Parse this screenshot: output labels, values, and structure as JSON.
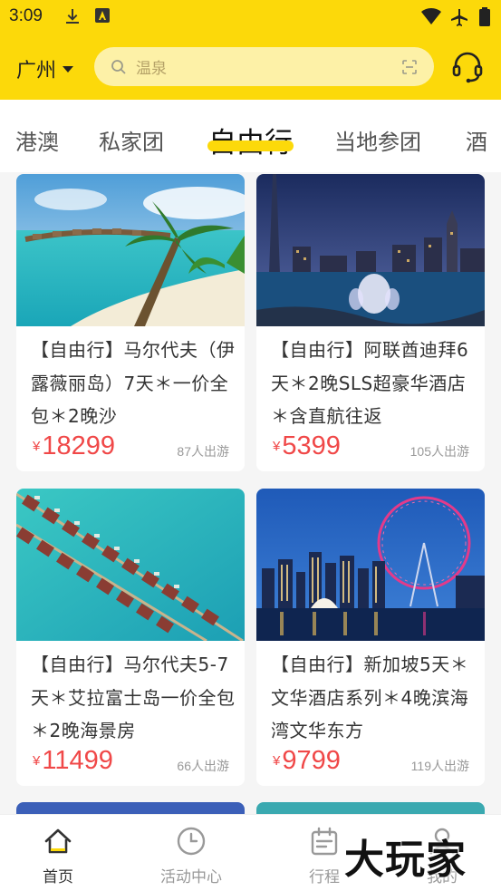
{
  "status_bar": {
    "time": "3:09"
  },
  "header": {
    "city": "广州",
    "search_placeholder": "温泉"
  },
  "tabs": [
    {
      "label": "港澳",
      "active": false
    },
    {
      "label": "私家团",
      "active": false
    },
    {
      "label": "自由行",
      "active": true
    },
    {
      "label": "当地参团",
      "active": false
    },
    {
      "label": "酒",
      "active": false
    }
  ],
  "cards": [
    {
      "title": "【自由行】马尔代夫（伊露薇丽岛）7天＊一价全包＊2晚沙",
      "currency": "¥",
      "price": "18299",
      "count": "87",
      "count_suffix": "人出游"
    },
    {
      "title": "【自由行】阿联酋迪拜6天＊2晚SLS超豪华酒店＊含直航往返",
      "currency": "¥",
      "price": "5399",
      "count": "105",
      "count_suffix": "人出游"
    },
    {
      "title": "【自由行】马尔代夫5-7天＊艾拉富士岛一价全包＊2晚海景房",
      "currency": "¥",
      "price": "11499",
      "count": "66",
      "count_suffix": "人出游"
    },
    {
      "title": "【自由行】新加坡5天＊文华酒店系列＊4晚滨海湾文华东方",
      "currency": "¥",
      "price": "9799",
      "count": "119",
      "count_suffix": "人出游"
    }
  ],
  "bottom_nav": [
    {
      "label": "首页",
      "icon": "home-icon",
      "active": true
    },
    {
      "label": "活动中心",
      "icon": "clock-icon",
      "active": false
    },
    {
      "label": "行程",
      "icon": "calendar-icon",
      "active": false
    },
    {
      "label": "我的",
      "icon": "user-icon",
      "active": false
    }
  ],
  "watermark": "大玩家",
  "colors": {
    "brand_yellow": "#fcd90a",
    "price_red": "#f04848"
  }
}
